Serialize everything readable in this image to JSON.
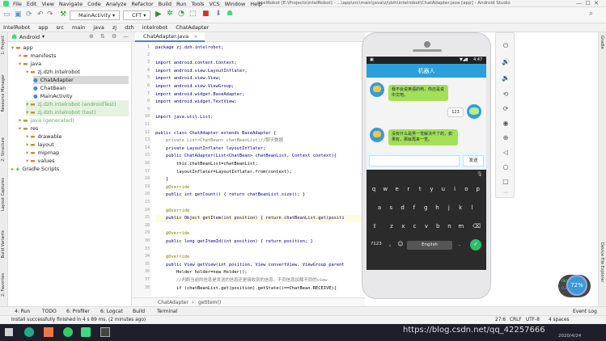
{
  "window": {
    "menu": [
      "File",
      "Edit",
      "View",
      "Navigate",
      "Code",
      "Analyze",
      "Refactor",
      "Build",
      "Run",
      "Tools",
      "VCS",
      "Window",
      "Help"
    ],
    "title": "intelRobot [E:\\Projects\\intelRobot] - ...\\app\\src\\main\\java\\zj\\dzh\\intelrobot\\ChatAdapter.java [app] - Android Studio"
  },
  "toolbar": {
    "run_config": "MainActivity",
    "device": "CFT"
  },
  "breadcrumbs": [
    "IntelRobot",
    "app",
    "src",
    "main",
    "java",
    "zj",
    "dzh",
    "intelrobot",
    "ChatAdapter"
  ],
  "project_panel": {
    "view_mode": "Android",
    "tree": [
      {
        "label": "app",
        "depth": 0
      },
      {
        "label": "manifests",
        "depth": 1
      },
      {
        "label": "java",
        "depth": 1
      },
      {
        "label": "zj.dzh.intelrobot",
        "depth": 2
      },
      {
        "label": "ChatAdapter",
        "depth": 3,
        "selected": true
      },
      {
        "label": "ChatBean",
        "depth": 3
      },
      {
        "label": "MainActivity",
        "depth": 3
      },
      {
        "label": "zj.dzh.intelrobot (androidTest)",
        "depth": 2
      },
      {
        "label": "zj.dzh.intelrobot (test)",
        "depth": 2
      },
      {
        "label": "java (generated)",
        "depth": 1
      },
      {
        "label": "res",
        "depth": 1
      },
      {
        "label": "drawable",
        "depth": 2
      },
      {
        "label": "layout",
        "depth": 2
      },
      {
        "label": "mipmap",
        "depth": 2
      },
      {
        "label": "values",
        "depth": 2
      },
      {
        "label": "Gradle Scripts",
        "depth": 0
      }
    ],
    "side_tabs": [
      "1: Project",
      "Resource Manager",
      "2: Structure",
      "Layout Captures",
      "Build Variants",
      "2: Favorites"
    ]
  },
  "editor": {
    "tab": "ChatAdapter.java",
    "lines": [
      {
        "n": "1",
        "code": "package zj.dzh.intelrobot;"
      },
      {
        "n": "2",
        "code": ""
      },
      {
        "n": "3",
        "code": "import android.content.Context;"
      },
      {
        "n": "4",
        "code": "import android.view.LayoutInflater;"
      },
      {
        "n": "5",
        "code": "import android.view.View;"
      },
      {
        "n": "6",
        "code": "import android.view.ViewGroup;"
      },
      {
        "n": "7",
        "code": "import android.widget.BaseAdapter;"
      },
      {
        "n": "8",
        "code": "import android.widget.TextView;"
      },
      {
        "n": "9",
        "code": ""
      },
      {
        "n": "10",
        "code": "import java.util.List;"
      },
      {
        "n": "11",
        "code": ""
      },
      {
        "n": "12",
        "code": "public class ChatAdapter extends BaseAdapter {"
      },
      {
        "n": "13",
        "code": "    private List<ChatBean> chatBeanList;//聊天数据"
      },
      {
        "n": "14",
        "code": "    private LayoutInflater layoutInflater;"
      },
      {
        "n": "15",
        "code": "    public ChatAdapter(List<ChatBean> chatBeanList, Context context){"
      },
      {
        "n": "16",
        "code": "        this.chatBeanList=chatBeanList;"
      },
      {
        "n": "17",
        "code": "        layoutInflater=LayoutInflater.from(context);"
      },
      {
        "n": "18",
        "code": "    }"
      },
      {
        "n": "19",
        "code": "    @Override"
      },
      {
        "n": "20",
        "code": "    public int getCount() { return chatBeanList.size(); }"
      },
      {
        "n": "23",
        "code": ""
      },
      {
        "n": "24",
        "code": "    @Override"
      },
      {
        "n": "25",
        "code": "    public Object getItem(int position) { return chatBeanList.get(positi"
      },
      {
        "n": "28",
        "code": ""
      },
      {
        "n": "29",
        "code": "    @Override"
      },
      {
        "n": "30",
        "code": "    public long getItemId(int position) { return position; }"
      },
      {
        "n": "33",
        "code": ""
      },
      {
        "n": "34",
        "code": "    @Override"
      },
      {
        "n": "35",
        "code": "    public View getView(int position, View convertView, ViewGroup parent"
      },
      {
        "n": "36",
        "code": "        Holder holder=new Holder();"
      },
      {
        "n": "37",
        "code": "        //判断当前的信息是发送的信息还是接收到的信息，不同信息加载不同的view"
      },
      {
        "n": "38",
        "code": "        if (chatBeanList.get(position).getState()==ChatBean.RECEIVE){"
      }
    ],
    "breadcrumb": [
      "ChatAdapter",
      "getItem()"
    ]
  },
  "emulator": {
    "status_time": "4:47",
    "app_title": "机器人",
    "messages": [
      {
        "from": "robot",
        "text": "我不会说英语的哟，你还是说中文吧。"
      },
      {
        "from": "user",
        "text": "123"
      },
      {
        "from": "robot",
        "text": "没有什么是男一觉解决不了的，如果有，那就再来一觉。"
      }
    ],
    "input_placeholder": "",
    "send_label": "发送",
    "keyboard": {
      "row1": [
        "q",
        "w",
        "e",
        "r",
        "t",
        "y",
        "u",
        "i",
        "o",
        "p"
      ],
      "row2": [
        "a",
        "s",
        "d",
        "f",
        "g",
        "h",
        "j",
        "k",
        "l"
      ],
      "row3": [
        "z",
        "x",
        "c",
        "v",
        "b",
        "n",
        "m"
      ],
      "sym": "?123",
      "space": "English",
      "comma": ",",
      "period": "."
    },
    "overlay": {
      "pct": "72%",
      "up": "0k/s",
      "down": "0.1k/s"
    }
  },
  "bottom_tabs": [
    "4: Run",
    "TODO",
    "6: Profiler",
    "6: Logcat",
    "Build",
    "Terminal",
    "Event Log"
  ],
  "status": {
    "message": "Install successfully finished in 4 s 89 ms. (2 minutes ago)",
    "pos": "27:6",
    "eol": "CRLF",
    "encoding": "UTF-8",
    "indent": "4 spaces"
  },
  "right_tabs": [
    "Gradle",
    "Device File Explorer"
  ],
  "taskbar": {
    "date": "2020/4/24",
    "watermark": "https://blog.csdn.net/qq_42257666"
  },
  "colors": {
    "appbar": "#2b9fd9",
    "bubble": "#a2e05a",
    "keyboard": "#2b2b2b",
    "accent": "#2bbf6a"
  }
}
